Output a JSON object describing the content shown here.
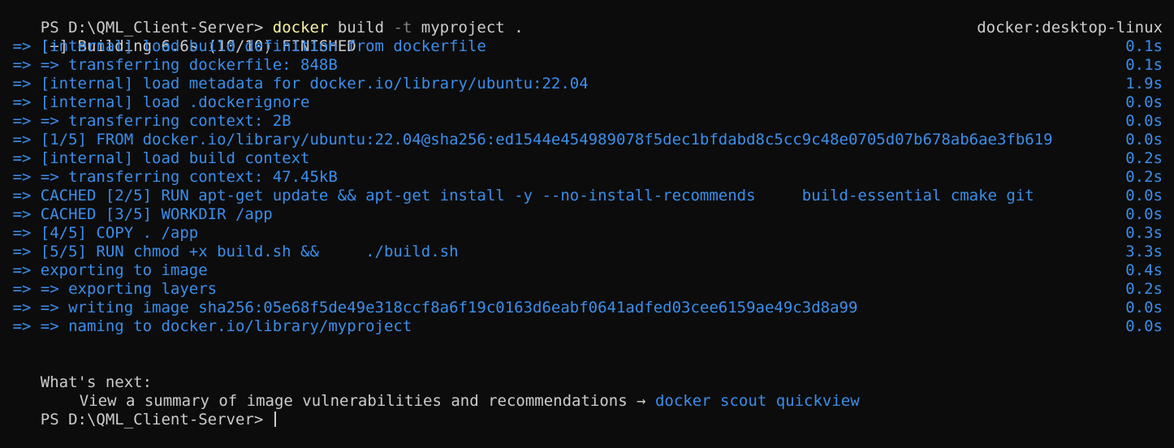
{
  "prompt": {
    "path": "PS D:\\QML_Client-Server> ",
    "cmd_exe": "docker",
    "cmd_args": " build ",
    "cmd_flag": "-t",
    "cmd_rest": " myproject ."
  },
  "status": {
    "left": "[+] Building 6.6s (10/10) FINISHED",
    "right": "docker:desktop-linux"
  },
  "steps": [
    {
      "text": " => [internal] load build definition from dockerfile",
      "time": "0.1s"
    },
    {
      "text": " => => transferring dockerfile: 848B",
      "time": "0.1s"
    },
    {
      "text": " => [internal] load metadata for docker.io/library/ubuntu:22.04",
      "time": "1.9s"
    },
    {
      "text": " => [internal] load .dockerignore",
      "time": "0.0s"
    },
    {
      "text": " => => transferring context: 2B",
      "time": "0.0s"
    },
    {
      "text": " => [1/5] FROM docker.io/library/ubuntu:22.04@sha256:ed1544e454989078f5dec1bfdabd8c5cc9c48e0705d07b678ab6ae3fb619",
      "time": "0.0s"
    },
    {
      "text": " => [internal] load build context",
      "time": "0.2s"
    },
    {
      "text": " => => transferring context: 47.45kB",
      "time": "0.2s"
    },
    {
      "text": " => CACHED [2/5] RUN apt-get update && apt-get install -y --no-install-recommends     build-essential cmake git",
      "time": "0.0s"
    },
    {
      "text": " => CACHED [3/5] WORKDIR /app",
      "time": "0.0s"
    },
    {
      "text": " => [4/5] COPY . /app",
      "time": "0.3s"
    },
    {
      "text": " => [5/5] RUN chmod +x build.sh &&     ./build.sh",
      "time": "3.3s"
    },
    {
      "text": " => exporting to image",
      "time": "0.4s"
    },
    {
      "text": " => => exporting layers",
      "time": "0.2s"
    },
    {
      "text": " => => writing image sha256:05e68f5de49e318ccf8a6f19c0163d6eabf0641adfed03cee6159ae49c3d8a99",
      "time": "0.0s"
    },
    {
      "text": " => => naming to docker.io/library/myproject",
      "time": "0.0s"
    }
  ],
  "whats_next": {
    "heading": "What's next:",
    "text": "View a summary of image vulnerabilities and recommendations → ",
    "link": "docker scout quickview"
  },
  "final_prompt": "PS D:\\QML_Client-Server> ",
  "colors": {
    "background": "#0c0c0c",
    "text": "#cccccc",
    "accent_blue": "#3b8eea",
    "command_yellow": "#f9f1a5"
  }
}
